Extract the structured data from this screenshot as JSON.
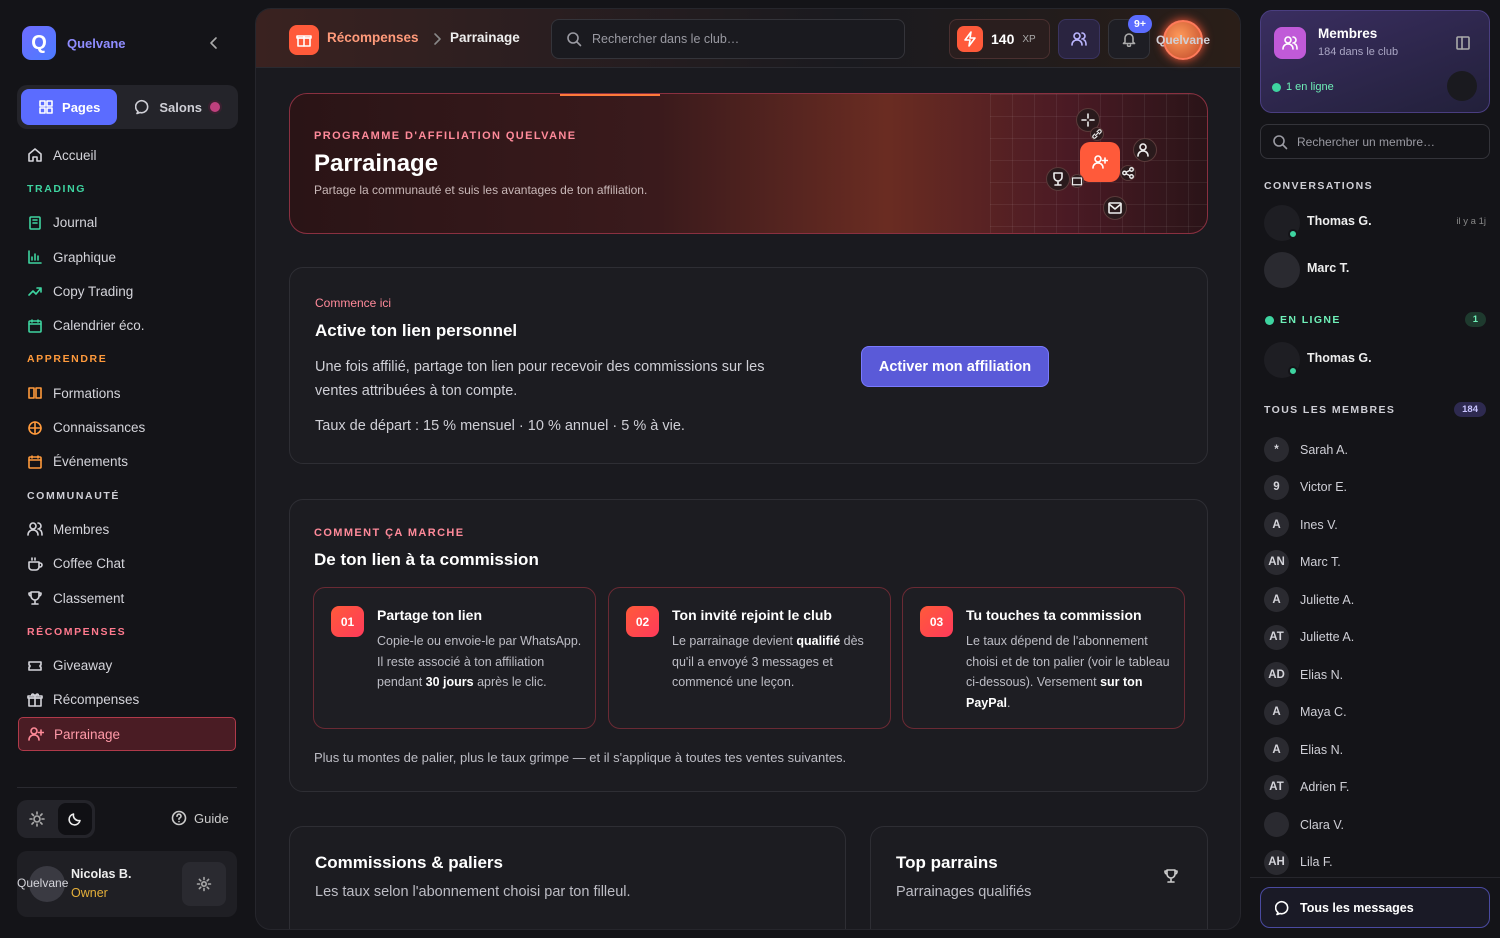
{
  "sidebar": {
    "logo_letter": "Q",
    "brand": "Quelvane",
    "tabs": {
      "pages": "Pages",
      "salons": "Salons"
    },
    "items": {
      "accueil": "Accueil",
      "trading_section": "TRADING",
      "journal": "Journal",
      "graphique": "Graphique",
      "copy_trading": "Copy Trading",
      "calendrier": "Calendrier éco.",
      "apprendre_section": "APPRENDRE",
      "formations": "Formations",
      "connaissances": "Connaissances",
      "evenements": "Événements",
      "communaute_section": "COMMUNAUTÉ",
      "membres": "Membres",
      "coffee_chat": "Coffee Chat",
      "classement": "Classement",
      "recompenses_section": "RÉCOMPENSES",
      "giveaway": "Giveaway",
      "recompenses": "Récompenses",
      "parrainage": "Parrainage"
    },
    "guide": "Guide",
    "user": {
      "avatar_text": "Quelvane",
      "name": "Nicolas B.",
      "role": "Owner"
    }
  },
  "topbar": {
    "breadcrumb_parent": "Récompenses",
    "breadcrumb_current": "Parrainage",
    "search_placeholder": "Rechercher dans le club…",
    "xp_value": "140",
    "xp_unit": "XP",
    "notif_badge": "9+",
    "avatar_text": "Quelvane"
  },
  "hero": {
    "kicker": "PROGRAMME D'AFFILIATION QUELVANE",
    "title": "Parrainage",
    "subtitle": "Partage la communauté et suis les avantages de ton affiliation."
  },
  "activate": {
    "kicker": "Commence ici",
    "title": "Active ton lien personnel",
    "description": "Une fois affilié, partage ton lien pour recevoir des commissions sur les ventes attribuées à ton compte.",
    "rates": "Taux de départ : 15 % mensuel · 10 % annuel · 5 % à vie.",
    "cta": "Activer mon affiliation"
  },
  "how": {
    "kicker": "COMMENT ÇA MARCHE",
    "title": "De ton lien à ta commission",
    "steps": [
      {
        "num": "01",
        "title": "Partage ton lien",
        "text_a": "Copie-le ou envoie-le par WhatsApp. Il reste associé à ton affiliation pendant ",
        "bold": "30 jours",
        "text_b": " après le clic."
      },
      {
        "num": "02",
        "title": "Ton invité rejoint le club",
        "text_a": "Le parrainage devient ",
        "bold": "qualifié",
        "text_b": " dès qu'il a envoyé 3 messages et commencé une leçon."
      },
      {
        "num": "03",
        "title": "Tu touches ta commission",
        "text_a": "Le taux dépend de l'abonnement choisi et de ton palier (voir le tableau ci-dessous). Versement ",
        "bold": "sur ton PayPal",
        "text_b": "."
      }
    ],
    "footer": "Plus tu montes de palier, plus le taux grimpe — et il s'applique à toutes tes ventes suivantes."
  },
  "commissions": {
    "title": "Commissions & paliers",
    "subtitle": "Les taux selon l'abonnement choisi par ton filleul."
  },
  "top": {
    "title": "Top parrains",
    "subtitle": "Parrainages qualifiés"
  },
  "right": {
    "members_title": "Membres",
    "members_sub": "184 dans le club",
    "online_text": "1 en ligne",
    "search_placeholder": "Rechercher un membre…",
    "conversations_label": "CONVERSATIONS",
    "conversations": [
      {
        "name": "Thomas G.",
        "time": "il y a 1j"
      },
      {
        "name": "Marc T.",
        "time": ""
      }
    ],
    "online_label": "EN LIGNE",
    "online_count": "1",
    "online": [
      {
        "name": "Thomas G."
      }
    ],
    "all_label": "TOUS LES MEMBRES",
    "all_count": "184",
    "members": [
      {
        "initials": "*",
        "name": "Sarah A."
      },
      {
        "initials": "9",
        "name": "Victor E."
      },
      {
        "initials": "A",
        "name": "Ines V."
      },
      {
        "initials": "AN",
        "name": "Marc T."
      },
      {
        "initials": "A",
        "name": "Juliette A."
      },
      {
        "initials": "AT",
        "name": "Juliette A."
      },
      {
        "initials": "AD",
        "name": "Elias N."
      },
      {
        "initials": "A",
        "name": "Maya C."
      },
      {
        "initials": "A",
        "name": "Elias N."
      },
      {
        "initials": "AT",
        "name": "Adrien F."
      },
      {
        "initials": "",
        "name": "Clara V."
      },
      {
        "initials": "AH",
        "name": "Lila F."
      }
    ],
    "all_messages": "Tous les messages"
  },
  "colors": {
    "accent": "#5b6cff",
    "brand_orange": "#ff5a3a",
    "success": "#3ed4a0",
    "rose": "#ff8a9a"
  }
}
